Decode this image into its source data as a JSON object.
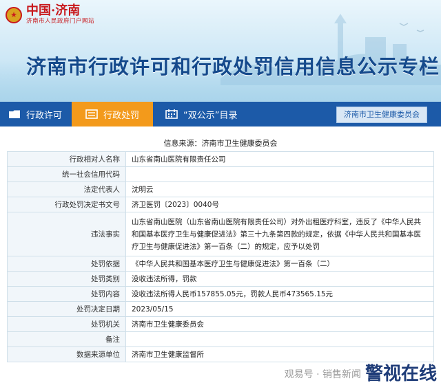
{
  "header": {
    "logo_main": "中国·济南",
    "logo_sub": "济南市人民政府门户网站",
    "title": "济南市行政许可和行政处罚信用信息公示专栏"
  },
  "nav": {
    "items": [
      {
        "label": "行政许可",
        "icon": "folder-icon"
      },
      {
        "label": "行政处罚",
        "icon": "list-icon",
        "active": true
      },
      {
        "label": "“双公示”目录",
        "icon": "calendar-icon"
      }
    ],
    "department": "济南市卫生健康委员会"
  },
  "record": {
    "source": "信息来源：济南市卫生健康委员会",
    "rows": [
      {
        "label": "行政相对人名称",
        "value": "山东省南山医院有限责任公司"
      },
      {
        "label": "统一社会信用代码",
        "value": ""
      },
      {
        "label": "法定代表人",
        "value": "沈明云"
      },
      {
        "label": "行政处罚决定书文号",
        "value": "济卫医罚〔2023〕0040号"
      },
      {
        "label": "违法事实",
        "value": "山东省南山医院（山东省南山医院有限责任公司）对外出租医疗科室，违反了《中华人民共和国基本医疗卫生与健康促进法》第三十九条第四款的规定，依据《中华人民共和国基本医疗卫生与健康促进法》第一百条（二）的规定，应予以处罚"
      },
      {
        "label": "处罚依据",
        "value": "《中华人民共和国基本医疗卫生与健康促进法》第一百条（二）"
      },
      {
        "label": "处罚类别",
        "value": "没收违法所得，罚款"
      },
      {
        "label": "处罚内容",
        "value": "没收违法所得人民币157855.05元，罚款人民币473565.15元"
      },
      {
        "label": "处罚决定日期",
        "value": "2023/05/15"
      },
      {
        "label": "处罚机关",
        "value": "济南市卫生健康委员会"
      },
      {
        "label": "备注",
        "value": ""
      },
      {
        "label": "数据来源单位",
        "value": "济南市卫生健康监督所"
      }
    ]
  },
  "watermark": {
    "left_text": "观易号 · 销售新闻",
    "logo": "警视在线"
  }
}
